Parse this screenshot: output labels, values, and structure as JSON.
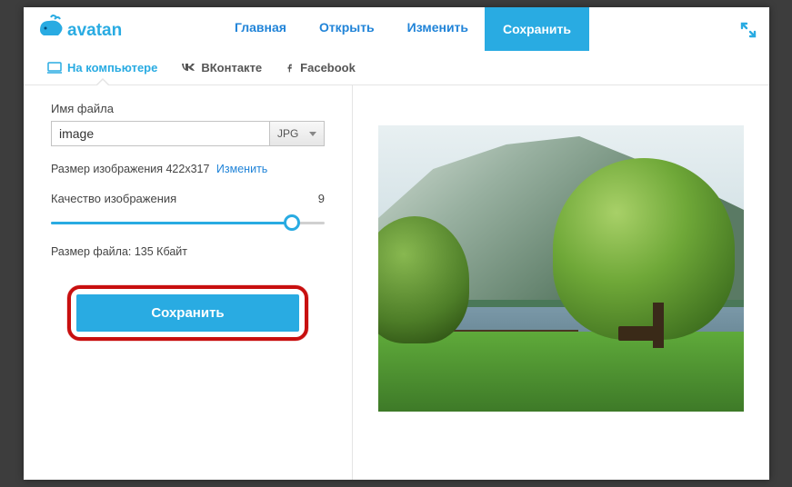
{
  "brand": "avatan",
  "nav": {
    "home": "Главная",
    "open": "Открыть",
    "edit": "Изменить",
    "save": "Сохранить"
  },
  "subtabs": {
    "computer": "На компьютере",
    "vk": "ВКонтакте",
    "facebook": "Facebook"
  },
  "panel": {
    "filename_label": "Имя файла",
    "filename_value": "image",
    "format": "JPG",
    "dimensions_label": "Размер изображения 422x317",
    "change_link": "Изменить",
    "quality_label": "Качество изображения",
    "quality_value": "9",
    "filesize_label": "Размер файла: 135 Кбайт",
    "save_button": "Сохранить"
  }
}
